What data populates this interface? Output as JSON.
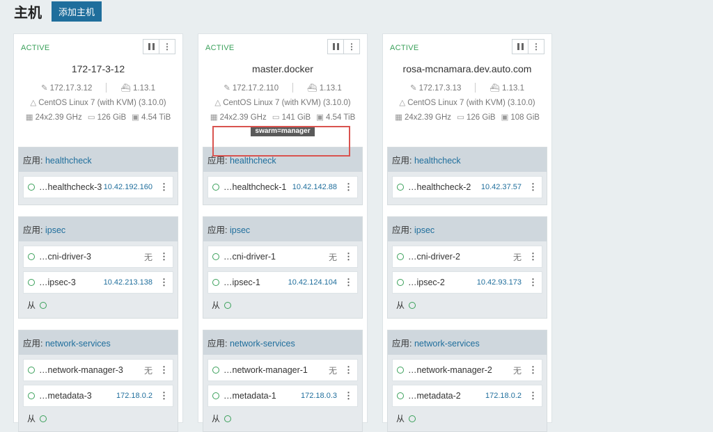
{
  "page": {
    "title": "主机",
    "add_button": "添加主机"
  },
  "hosts": [
    {
      "state": "ACTIVE",
      "name": "172-17-3-12",
      "ip": "172.17.3.12",
      "docker": "1.13.1",
      "os": "CentOS Linux 7 (with KVM) (3.10.0)",
      "cpu": "24x2.39 GHz",
      "mem": "126 GiB",
      "disk": "4.54 TiB",
      "label": "",
      "stacks": [
        {
          "prefix": "应用:",
          "name": "healthcheck",
          "services": [
            {
              "name": "…healthcheck-3",
              "ip": "10.42.192.160"
            }
          ],
          "sidekick": ""
        },
        {
          "prefix": "应用:",
          "name": "ipsec",
          "services": [
            {
              "name": "…cni-driver-3",
              "ip": "无"
            },
            {
              "name": "…ipsec-3",
              "ip": "10.42.213.138"
            }
          ],
          "sidekick": "从"
        },
        {
          "prefix": "应用:",
          "name": "network-services",
          "services": [
            {
              "name": "…network-manager-3",
              "ip": "无"
            },
            {
              "name": "…metadata-3",
              "ip": "172.18.0.2"
            }
          ],
          "sidekick": "从"
        }
      ]
    },
    {
      "state": "ACTIVE",
      "name": "master.docker",
      "ip": "172.17.2.110",
      "docker": "1.13.1",
      "os": "CentOS Linux 7 (with KVM) (3.10.0)",
      "cpu": "24x2.39 GHz",
      "mem": "141 GiB",
      "disk": "4.54 TiB",
      "label": "swarm=manager",
      "stacks": [
        {
          "prefix": "应用:",
          "name": "healthcheck",
          "services": [
            {
              "name": "…healthcheck-1",
              "ip": "10.42.142.88"
            }
          ],
          "sidekick": ""
        },
        {
          "prefix": "应用:",
          "name": "ipsec",
          "services": [
            {
              "name": "…cni-driver-1",
              "ip": "无"
            },
            {
              "name": "…ipsec-1",
              "ip": "10.42.124.104"
            }
          ],
          "sidekick": "从"
        },
        {
          "prefix": "应用:",
          "name": "network-services",
          "services": [
            {
              "name": "…network-manager-1",
              "ip": "无"
            },
            {
              "name": "…metadata-1",
              "ip": "172.18.0.3"
            }
          ],
          "sidekick": "从"
        }
      ]
    },
    {
      "state": "ACTIVE",
      "name": "rosa-mcnamara.dev.auto.com",
      "ip": "172.17.3.13",
      "docker": "1.13.1",
      "os": "CentOS Linux 7 (with KVM) (3.10.0)",
      "cpu": "24x2.39 GHz",
      "mem": "126 GiB",
      "disk": "108 GiB",
      "label": "",
      "stacks": [
        {
          "prefix": "应用:",
          "name": "healthcheck",
          "services": [
            {
              "name": "…healthcheck-2",
              "ip": "10.42.37.57"
            }
          ],
          "sidekick": ""
        },
        {
          "prefix": "应用:",
          "name": "ipsec",
          "services": [
            {
              "name": "…cni-driver-2",
              "ip": "无"
            },
            {
              "name": "…ipsec-2",
              "ip": "10.42.93.173"
            }
          ],
          "sidekick": "从"
        },
        {
          "prefix": "应用:",
          "name": "network-services",
          "services": [
            {
              "name": "…network-manager-2",
              "ip": "无"
            },
            {
              "name": "…metadata-2",
              "ip": "172.18.0.2"
            }
          ],
          "sidekick": "从"
        }
      ]
    }
  ],
  "colors": {
    "accent": "#1f6e9c",
    "active": "#3aa05a",
    "background": "#e9eef0",
    "highlight": "#d9534f"
  }
}
